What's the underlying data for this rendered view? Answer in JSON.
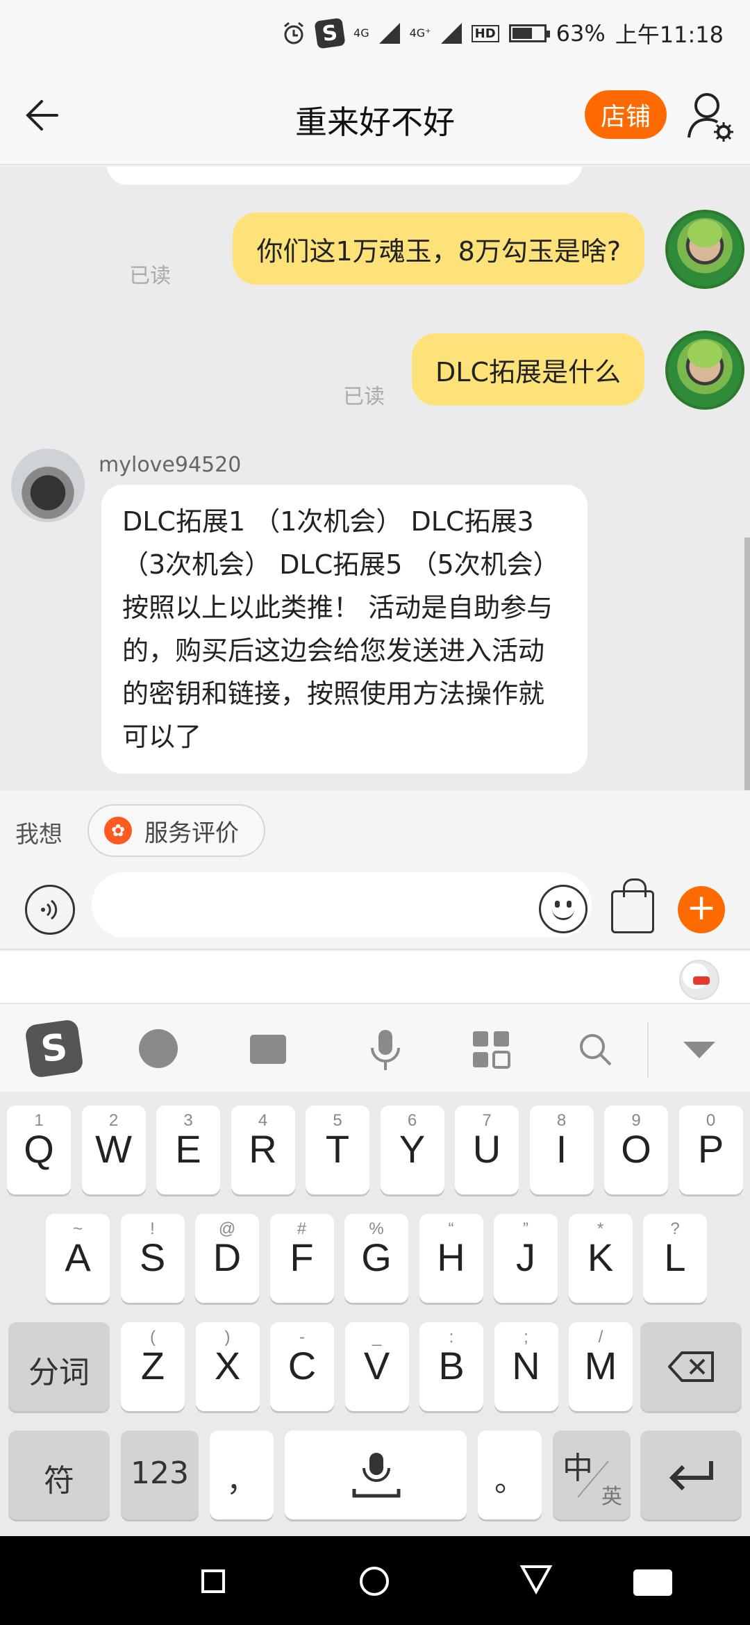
{
  "status_bar": {
    "network_4g": "4G",
    "network_4g_plus": "4G⁺",
    "hd": "HD",
    "battery": "63%",
    "time": "上午11:18"
  },
  "header": {
    "title": "重来好不好",
    "shop_label": "店铺"
  },
  "chat": {
    "messages": [
      {
        "side": "right",
        "text": "你们这1万魂玉，8万勾玉是啥?",
        "read_label": "已读"
      },
      {
        "side": "right",
        "text": "DLC拓展是什么",
        "read_label": "已读"
      },
      {
        "side": "left",
        "sender": "mylove94520",
        "text": "DLC拓展1 （1次机会） DLC拓展3 （3次机会） DLC拓展5 （5次机会） 按照以上以此类推！  活动是自助参与的，购买后这边会给您发送进入活动的密钥和链接，按照使用方法操作就可以了"
      }
    ]
  },
  "quick_reply": {
    "label": "我想",
    "chip_label": "服务评价"
  },
  "input": {
    "value": "",
    "placeholder": ""
  },
  "keyboard": {
    "row1": [
      {
        "sub": "1",
        "main": "Q"
      },
      {
        "sub": "2",
        "main": "W"
      },
      {
        "sub": "3",
        "main": "E"
      },
      {
        "sub": "4",
        "main": "R"
      },
      {
        "sub": "5",
        "main": "T"
      },
      {
        "sub": "6",
        "main": "Y"
      },
      {
        "sub": "7",
        "main": "U"
      },
      {
        "sub": "8",
        "main": "I"
      },
      {
        "sub": "9",
        "main": "O"
      },
      {
        "sub": "0",
        "main": "P"
      }
    ],
    "row2": [
      {
        "sub": "~",
        "main": "A"
      },
      {
        "sub": "!",
        "main": "S"
      },
      {
        "sub": "@",
        "main": "D"
      },
      {
        "sub": "#",
        "main": "F"
      },
      {
        "sub": "%",
        "main": "G"
      },
      {
        "sub": "“",
        "main": "H"
      },
      {
        "sub": "”",
        "main": "J"
      },
      {
        "sub": "*",
        "main": "K"
      },
      {
        "sub": "?",
        "main": "L"
      }
    ],
    "row3": [
      {
        "sub": "(",
        "main": "Z"
      },
      {
        "sub": ")",
        "main": "X"
      },
      {
        "sub": "-",
        "main": "C"
      },
      {
        "sub": "_",
        "main": "V"
      },
      {
        "sub": ":",
        "main": "B"
      },
      {
        "sub": ";",
        "main": "N"
      },
      {
        "sub": "/",
        "main": "M"
      }
    ],
    "fenci": "分词",
    "fu": "符",
    "num": "123",
    "comma": "，",
    "period": "。",
    "zh": "中",
    "en": "英"
  },
  "colors": {
    "accent": "#ff6a00",
    "bubble_me": "#fde27a",
    "bubble_other": "#ffffff"
  }
}
